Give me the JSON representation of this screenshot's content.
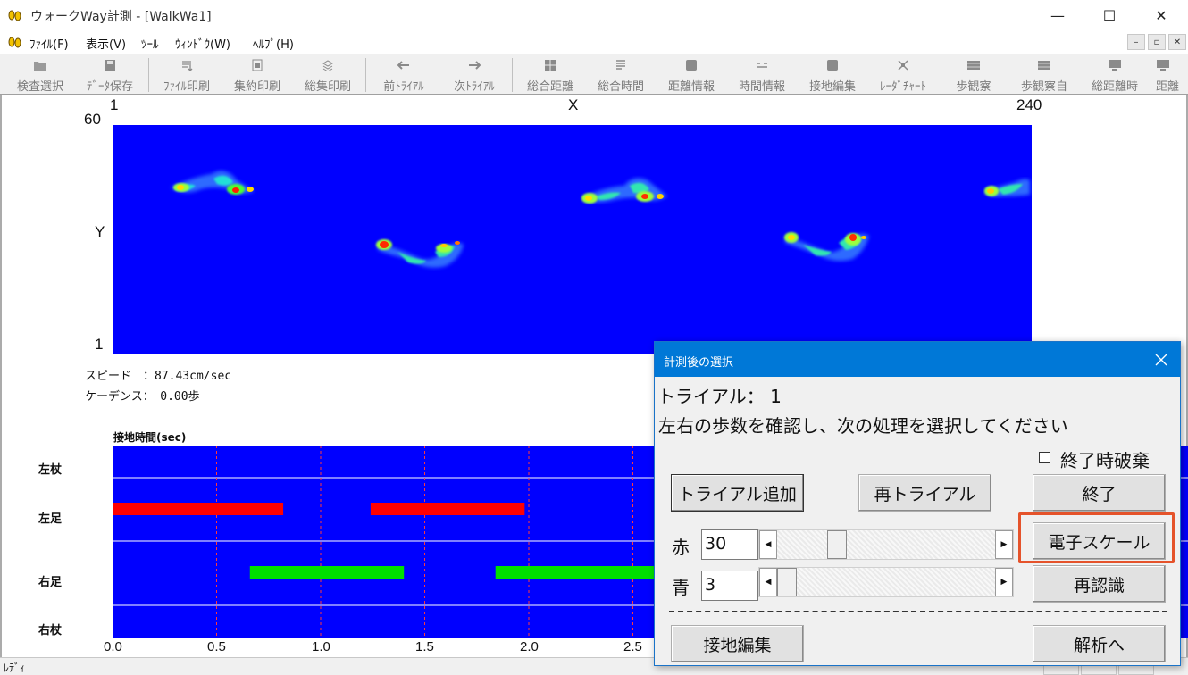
{
  "window": {
    "title": "ウォークWay計測 - [WalkWa1]",
    "minimize": "—",
    "maximize": "☐",
    "close": "✕"
  },
  "menu": [
    "ﾌｧｲﾙ(F)",
    "表示(V)",
    "ﾂｰﾙ",
    "ｳｨﾝﾄﾞｳ(W)",
    "ﾍﾙﾌﾟ(H)"
  ],
  "mdi_buttons": [
    "–",
    "▫",
    "✕"
  ],
  "toolbar": [
    {
      "label": "検査選択",
      "icon": "folder-open-icon"
    },
    {
      "label": "ﾃﾞｰﾀ保存",
      "icon": "floppy-disk-icon"
    },
    {
      "label": "ﾌｧｲﾙ印刷",
      "icon": "file-print-icon"
    },
    {
      "label": "集約印刷",
      "icon": "summary-print-icon"
    },
    {
      "label": "総集印刷",
      "icon": "stack-print-icon"
    },
    {
      "label": "前ﾄﾗｲｱﾙ",
      "icon": "arrow-left-icon"
    },
    {
      "label": "次ﾄﾗｲｱﾙ",
      "icon": "arrow-right-icon"
    },
    {
      "label": "総合距離",
      "icon": "grid-icon"
    },
    {
      "label": "総合時間",
      "icon": "lines-icon"
    },
    {
      "label": "距離情報",
      "icon": "square-icon"
    },
    {
      "label": "時間情報",
      "icon": "dashes-icon"
    },
    {
      "label": "接地編集",
      "icon": "square-icon"
    },
    {
      "label": "ﾚｰﾀﾞﾁｬｰﾄ",
      "icon": "radar-icon"
    },
    {
      "label": "歩観察",
      "icon": "film-icon"
    },
    {
      "label": "歩観察自",
      "icon": "film-icon"
    },
    {
      "label": "総距離時",
      "icon": "monitor-icon"
    },
    {
      "label": "距離",
      "icon": "monitor-icon"
    }
  ],
  "heatmap": {
    "x_axis_label": "X",
    "x_min": "1",
    "x_max": "240",
    "y_axis_label": "Y",
    "y_max": "60",
    "y_min": "1"
  },
  "stats": {
    "speed": "スピード　：87.43cm/sec",
    "cadence": "ケーデンス：　0.00歩"
  },
  "gantt": {
    "title": "接地時間(sec)",
    "rows": [
      "左杖",
      "左足",
      "右足",
      "右杖"
    ],
    "ticks": [
      "0.0",
      "0.5",
      "1.0",
      "1.5",
      "2.0",
      "2.5"
    ],
    "x_min": 0.0,
    "x_max": 5.2,
    "bars": [
      {
        "row": "左足",
        "start": 0.0,
        "end": 0.82,
        "color": "#ff0000"
      },
      {
        "row": "左足",
        "start": 1.24,
        "end": 1.98,
        "color": "#ff0000"
      },
      {
        "row": "右足",
        "start": 0.66,
        "end": 1.4,
        "color": "#00e000"
      },
      {
        "row": "右足",
        "start": 1.84,
        "end": 2.62,
        "color": "#00e000"
      }
    ]
  },
  "status": "ﾚﾃﾞｨ",
  "dialog": {
    "title": "計測後の選択",
    "trial": "トライアル：  1",
    "instruction": "左右の歩数を確認し、次の処理を選択してください",
    "discard_label": "終了時破棄",
    "discard_checked": false,
    "buttons": {
      "add_trial": "トライアル追加",
      "retrial": "再トライアル",
      "finish": "終了",
      "e_scale": "電子スケール",
      "recognize": "再認識",
      "edit_contact": "接地編集",
      "analyze": "解析へ"
    },
    "red": {
      "label": "赤",
      "value": "30",
      "level": 0.25
    },
    "blue": {
      "label": "青",
      "value": "3",
      "level": 0.0
    },
    "highlight_color": "#e5532b"
  },
  "colors": {
    "heatmap_bg": "#0000ff",
    "dialog_title": "#0078d7",
    "left_bar": "#ff0000",
    "right_bar": "#00e000"
  }
}
